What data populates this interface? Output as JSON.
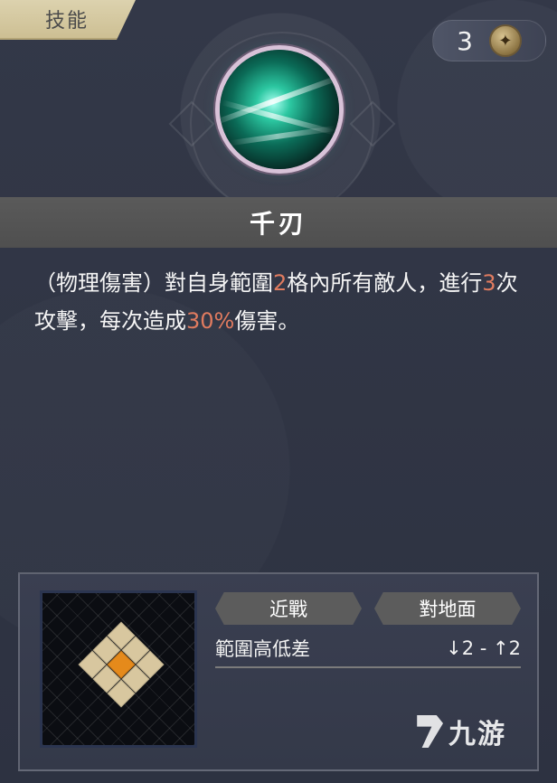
{
  "header": {
    "tab_label": "技能",
    "cost_value": "3",
    "cost_icon": "sparkle-icon"
  },
  "skill": {
    "icon": "blade-storm-icon",
    "name": "千刃",
    "description_parts": {
      "p1": "（物理傷害）對自身範圍",
      "h1": "2",
      "p2": "格內所有敵人，進行",
      "h2": "3",
      "p3": "次攻擊，每次造成",
      "h3": "30%",
      "p4": "傷害。"
    }
  },
  "details": {
    "tags": [
      "近戰",
      "對地面"
    ],
    "range_label": "範圍高低差",
    "range_value": "↓2 - ↑2",
    "grid_icon": "attack-range-grid"
  },
  "watermark": {
    "logo_icon": "jiuyou-logo-icon",
    "text": "九游"
  },
  "colors": {
    "highlight": "#e07b5f",
    "tab_bg": "#d6caa3",
    "grid_center": "#e58a1b",
    "grid_tile": "#d8c79f"
  }
}
